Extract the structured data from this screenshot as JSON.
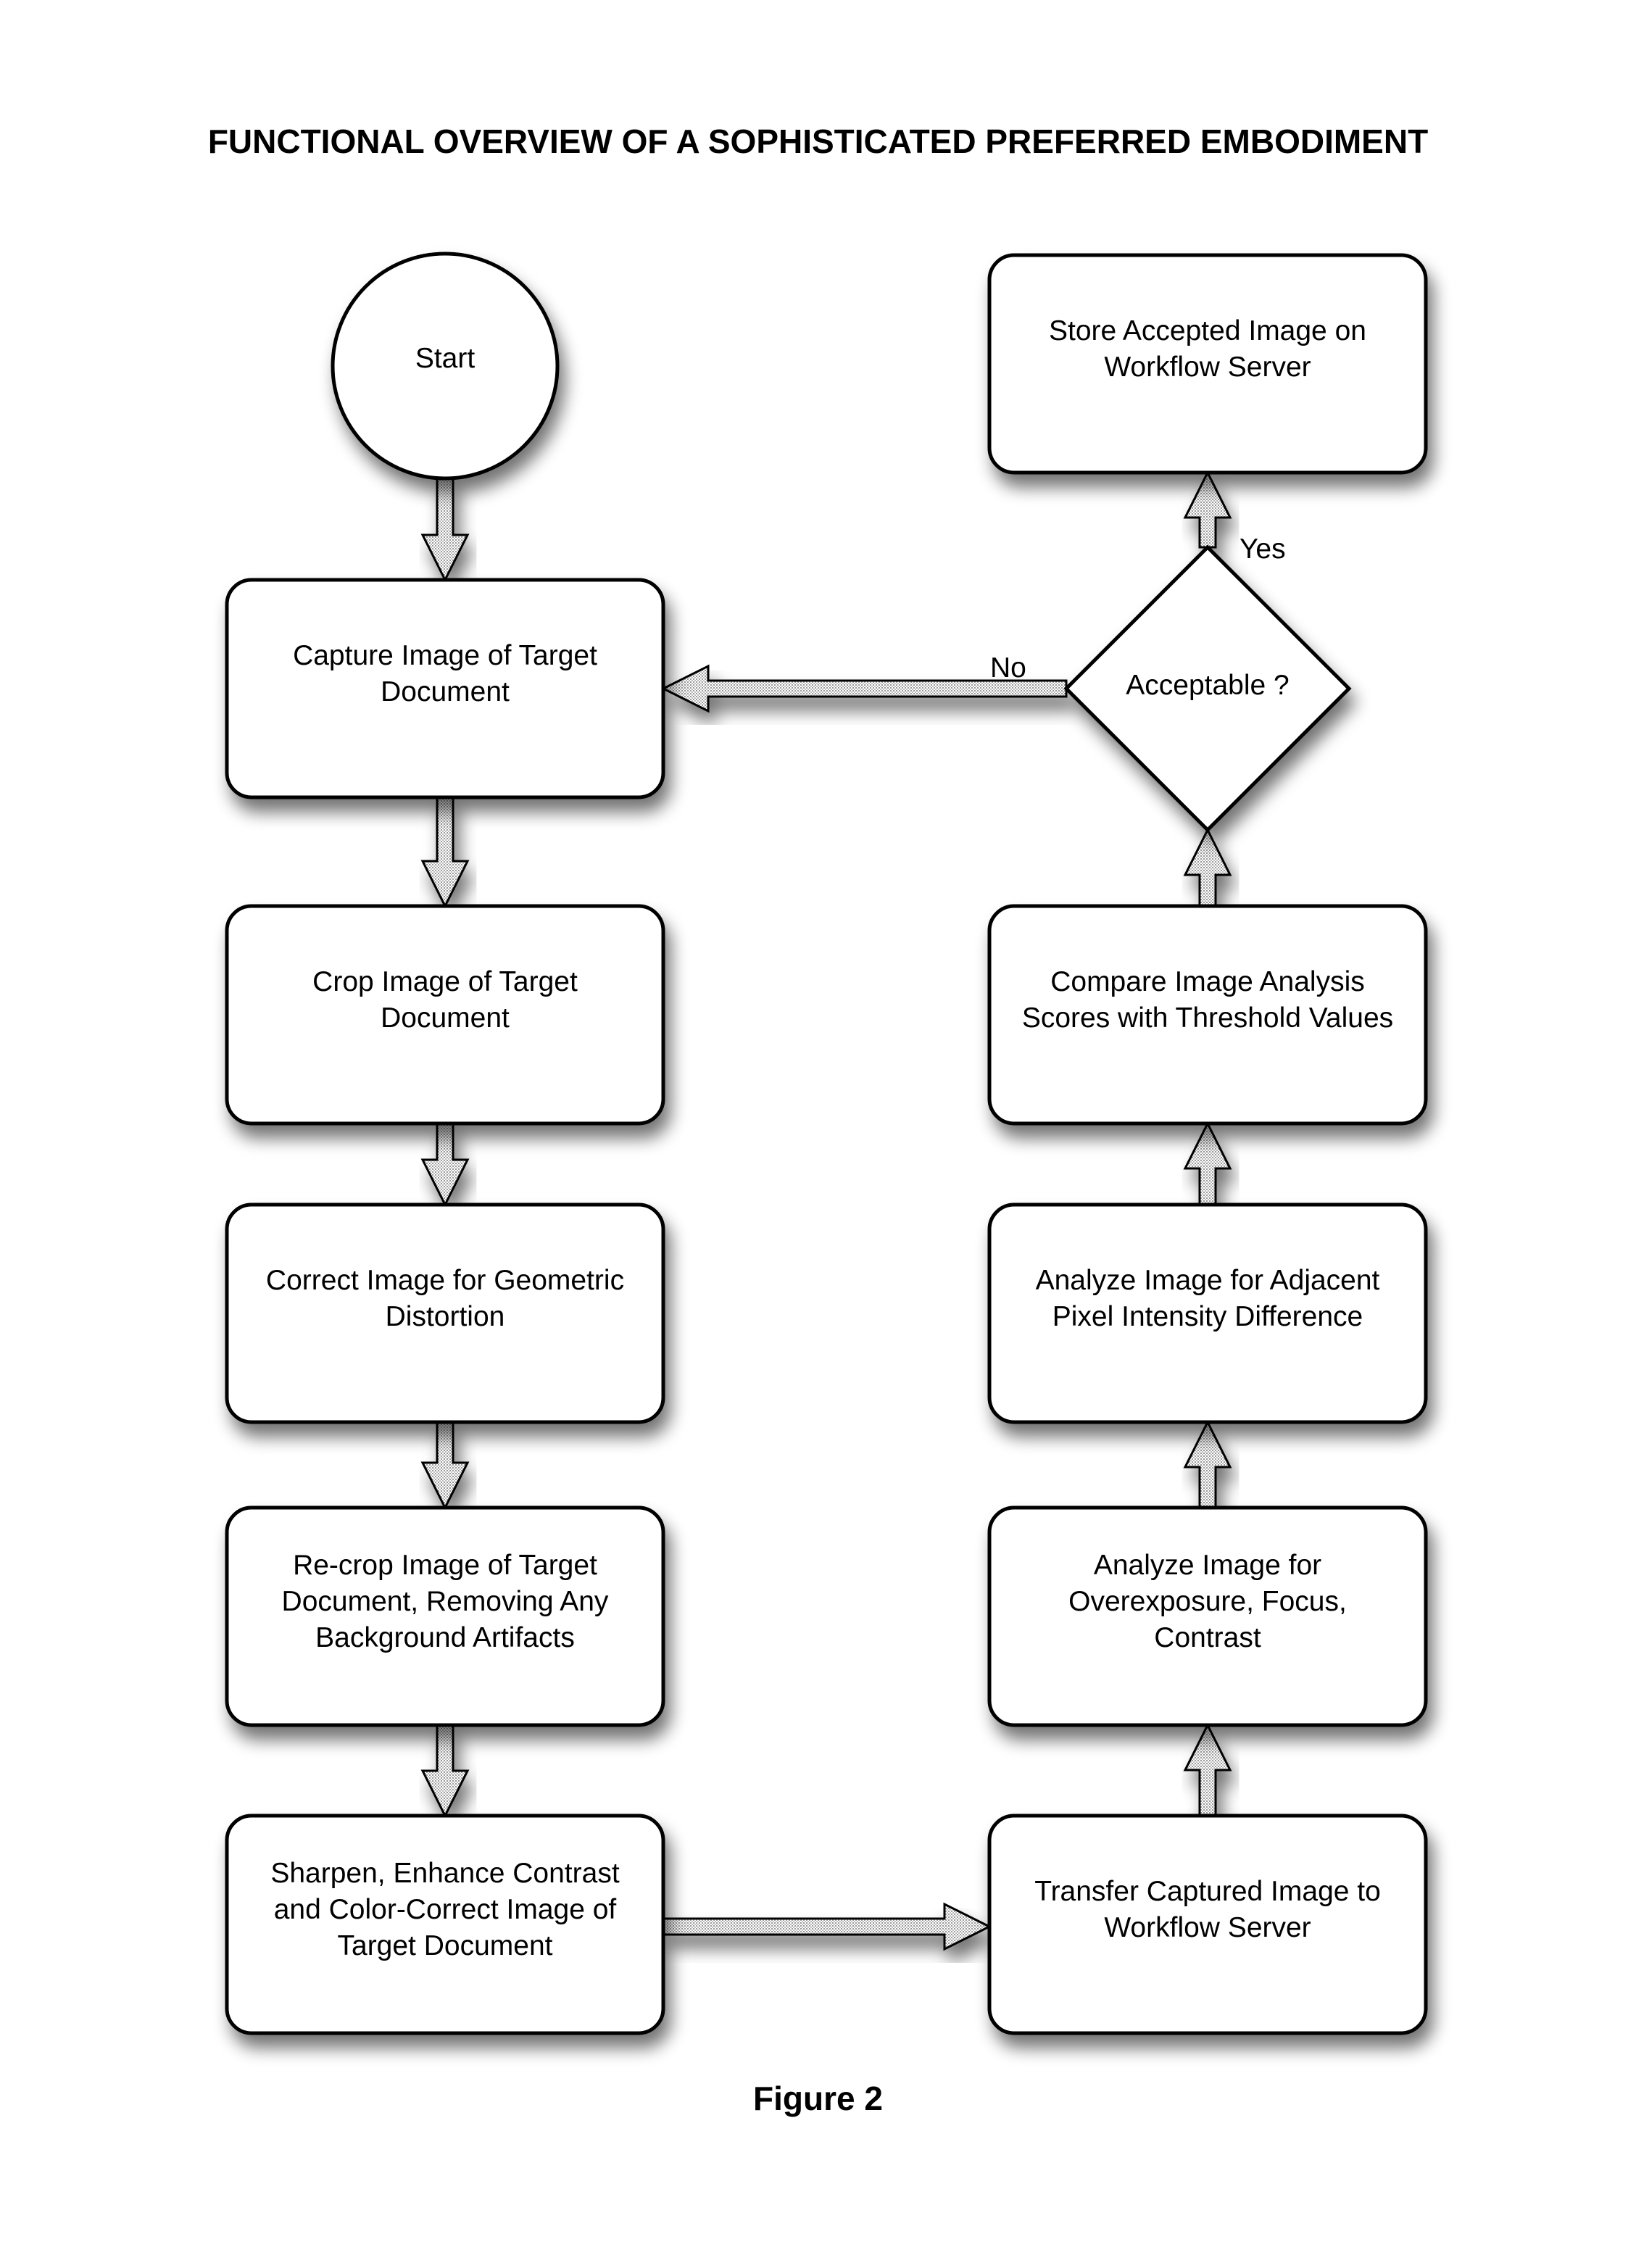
{
  "title": "FUNCTIONAL OVERVIEW OF A SOPHISTICATED PREFERRED EMBODIMENT",
  "figure_label": "Figure 2",
  "nodes": {
    "start": {
      "label": "Start",
      "shape": "circle"
    },
    "capture": {
      "label": "Capture Image of Target\nDocument",
      "shape": "rounded-rect"
    },
    "crop": {
      "label": "Crop Image of Target\nDocument",
      "shape": "rounded-rect"
    },
    "correct": {
      "label": "Correct Image for Geometric\nDistortion",
      "shape": "rounded-rect"
    },
    "recrop": {
      "label": "Re-crop Image of Target\nDocument, Removing Any\nBackground Artifacts",
      "shape": "rounded-rect"
    },
    "sharpen": {
      "label": "Sharpen, Enhance Contrast\nand Color-Correct Image of\nTarget Document",
      "shape": "rounded-rect"
    },
    "transfer": {
      "label": "Transfer Captured Image to\nWorkflow Server",
      "shape": "rounded-rect"
    },
    "overexposure": {
      "label": "Analyze Image for\nOverexposure, Focus,\nContrast",
      "shape": "rounded-rect"
    },
    "adjacent": {
      "label": "Analyze Image for Adjacent\nPixel Intensity Difference",
      "shape": "rounded-rect"
    },
    "compare": {
      "label": "Compare Image Analysis\nScores with Threshold Values",
      "shape": "rounded-rect"
    },
    "acceptable": {
      "label": "Acceptable ?",
      "shape": "diamond"
    },
    "store": {
      "label": "Store Accepted Image on\nWorkflow Server",
      "shape": "rounded-rect"
    }
  },
  "edges": [
    {
      "from": "start",
      "to": "capture",
      "label": ""
    },
    {
      "from": "capture",
      "to": "crop",
      "label": ""
    },
    {
      "from": "crop",
      "to": "correct",
      "label": ""
    },
    {
      "from": "correct",
      "to": "recrop",
      "label": ""
    },
    {
      "from": "recrop",
      "to": "sharpen",
      "label": ""
    },
    {
      "from": "sharpen",
      "to": "transfer",
      "label": ""
    },
    {
      "from": "transfer",
      "to": "overexposure",
      "label": ""
    },
    {
      "from": "overexposure",
      "to": "adjacent",
      "label": ""
    },
    {
      "from": "adjacent",
      "to": "compare",
      "label": ""
    },
    {
      "from": "compare",
      "to": "acceptable",
      "label": ""
    },
    {
      "from": "acceptable",
      "to": "store",
      "label": "Yes"
    },
    {
      "from": "acceptable",
      "to": "capture",
      "label": "No"
    }
  ],
  "edge_labels": {
    "yes": "Yes",
    "no": "No"
  }
}
